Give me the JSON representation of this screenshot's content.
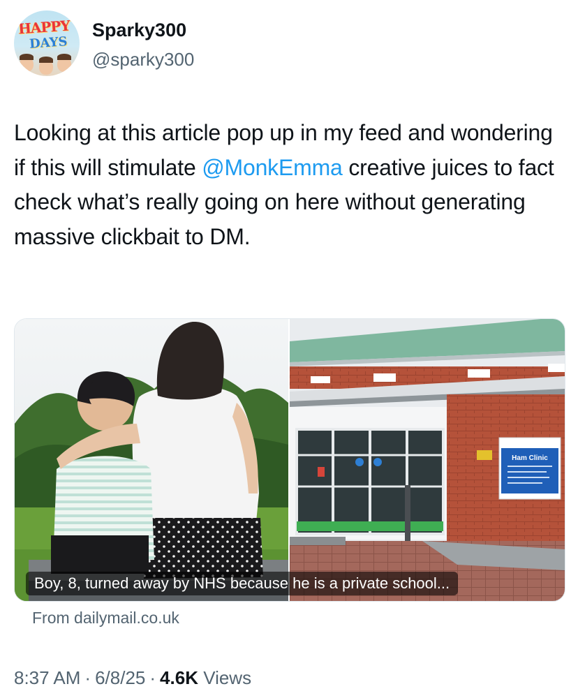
{
  "author": {
    "display_name": "Sparky300",
    "handle": "@sparky300",
    "avatar_text_line1": "HAPPY",
    "avatar_text_line2": "DAYS"
  },
  "tweet": {
    "text_before": "Looking at this article pop up in my feed and wondering if this will stimulate ",
    "mention": "@MonkEmma",
    "text_after": " creative juices to fact check what’s really going on here without generating massive clickbait to DM."
  },
  "link_card": {
    "caption": "Boy, 8, turned away by NHS because he is a private school...",
    "source": "From dailymail.co.uk",
    "sign_title": "Ham Clinic"
  },
  "meta": {
    "time": "8:37 AM",
    "date": "6/8/25",
    "views_count": "4.6K",
    "views_label": "Views"
  },
  "colors": {
    "accent": "#1d9bf0",
    "text_primary": "#0f1419",
    "text_secondary": "#536471"
  }
}
